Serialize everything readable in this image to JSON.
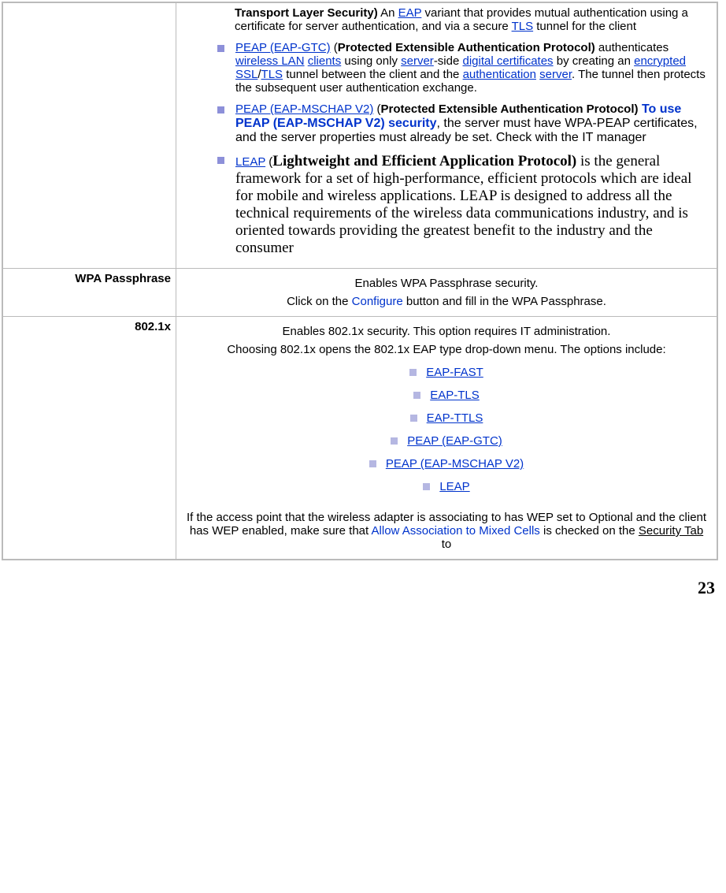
{
  "row1": {
    "label": "",
    "top": {
      "bold1": "Transport Layer Security)",
      "t1": " An ",
      "link1": "EAP",
      "t2": " variant that provides mutual authentication using a certificate for server authentication, and via a secure ",
      "link2": "TLS",
      "t3": " tunnel for the client"
    },
    "b1": {
      "link": "PEAP (EAP-GTC)",
      "paren_open": "  (",
      "bold": "Protected Extensible Authentication Protocol)",
      "t1": " authenticates ",
      "link_wlan": "wireless LAN",
      "sp1": " ",
      "link_clients": "clients",
      "t2": " using only ",
      "link_server": "server",
      "t3": "-side ",
      "link_dc": "digital certificates",
      "t4": " by creating an ",
      "link_enc": "encrypted",
      "sp2": " ",
      "link_ssl": "SSL",
      "slash": "/",
      "link_tls": "TLS",
      "t5": " tunnel between the client and the ",
      "link_auth": "authentication",
      "sp3": " ",
      "link_srv2": "server",
      "t6": ". The tunnel then protects the subsequent user authentication exchange."
    },
    "b2": {
      "link": "PEAP (EAP-MSCHAP V2)",
      "paren_open": " (",
      "bold": "Protected Extensible Authentication Protocol)",
      "bold_blue": " To use PEAP (EAP-MSCHAP V2) security",
      "t1": ", the server must have WPA-PEAP certificates, and the server properties must already be set. Check with the IT manager"
    },
    "b3": {
      "link": "LEAP",
      "paren_open": "  (",
      "bold_serif": "Lightweight and Efficient Application Protocol)",
      "t1": " is the general framework for a set of high-performance, efficient protocols which are ideal for mobile and wireless applications. LEAP is designed to address all the technical requirements of the wireless data communications industry, and is oriented towards providing the greatest benefit to the industry and the consumer"
    }
  },
  "row2": {
    "label": "WPA Passphrase",
    "line1": "Enables WPA Passphrase security.",
    "line2a": "Click on the ",
    "line2_link": "Configure",
    "line2b": " button and fill in the WPA Passphrase."
  },
  "row3": {
    "label": "802.1x",
    "line1": "Enables 802.1x security.   This option requires IT administration.",
    "line2": "Choosing 802.1x opens the 802.1x EAP type drop-down menu.   The options include:",
    "opts": {
      "o1": "EAP-FAST",
      "o2": "EAP-TLS",
      "o3": "EAP-TTLS",
      "o4": "PEAP (EAP-GTC)",
      "o5": "PEAP (EAP-MSCHAP V2)",
      "o6": "LEAP"
    },
    "tail1": "If the access point that the wireless adapter is associating to has WEP set to Optional and the client has WEP enabled, make sure that ",
    "tail_link1": "Allow Association to Mixed Cells",
    "tail2": " is checked on the ",
    "tail_link2": "Security Tab",
    "tail3": " to"
  },
  "pageNumber": "23"
}
